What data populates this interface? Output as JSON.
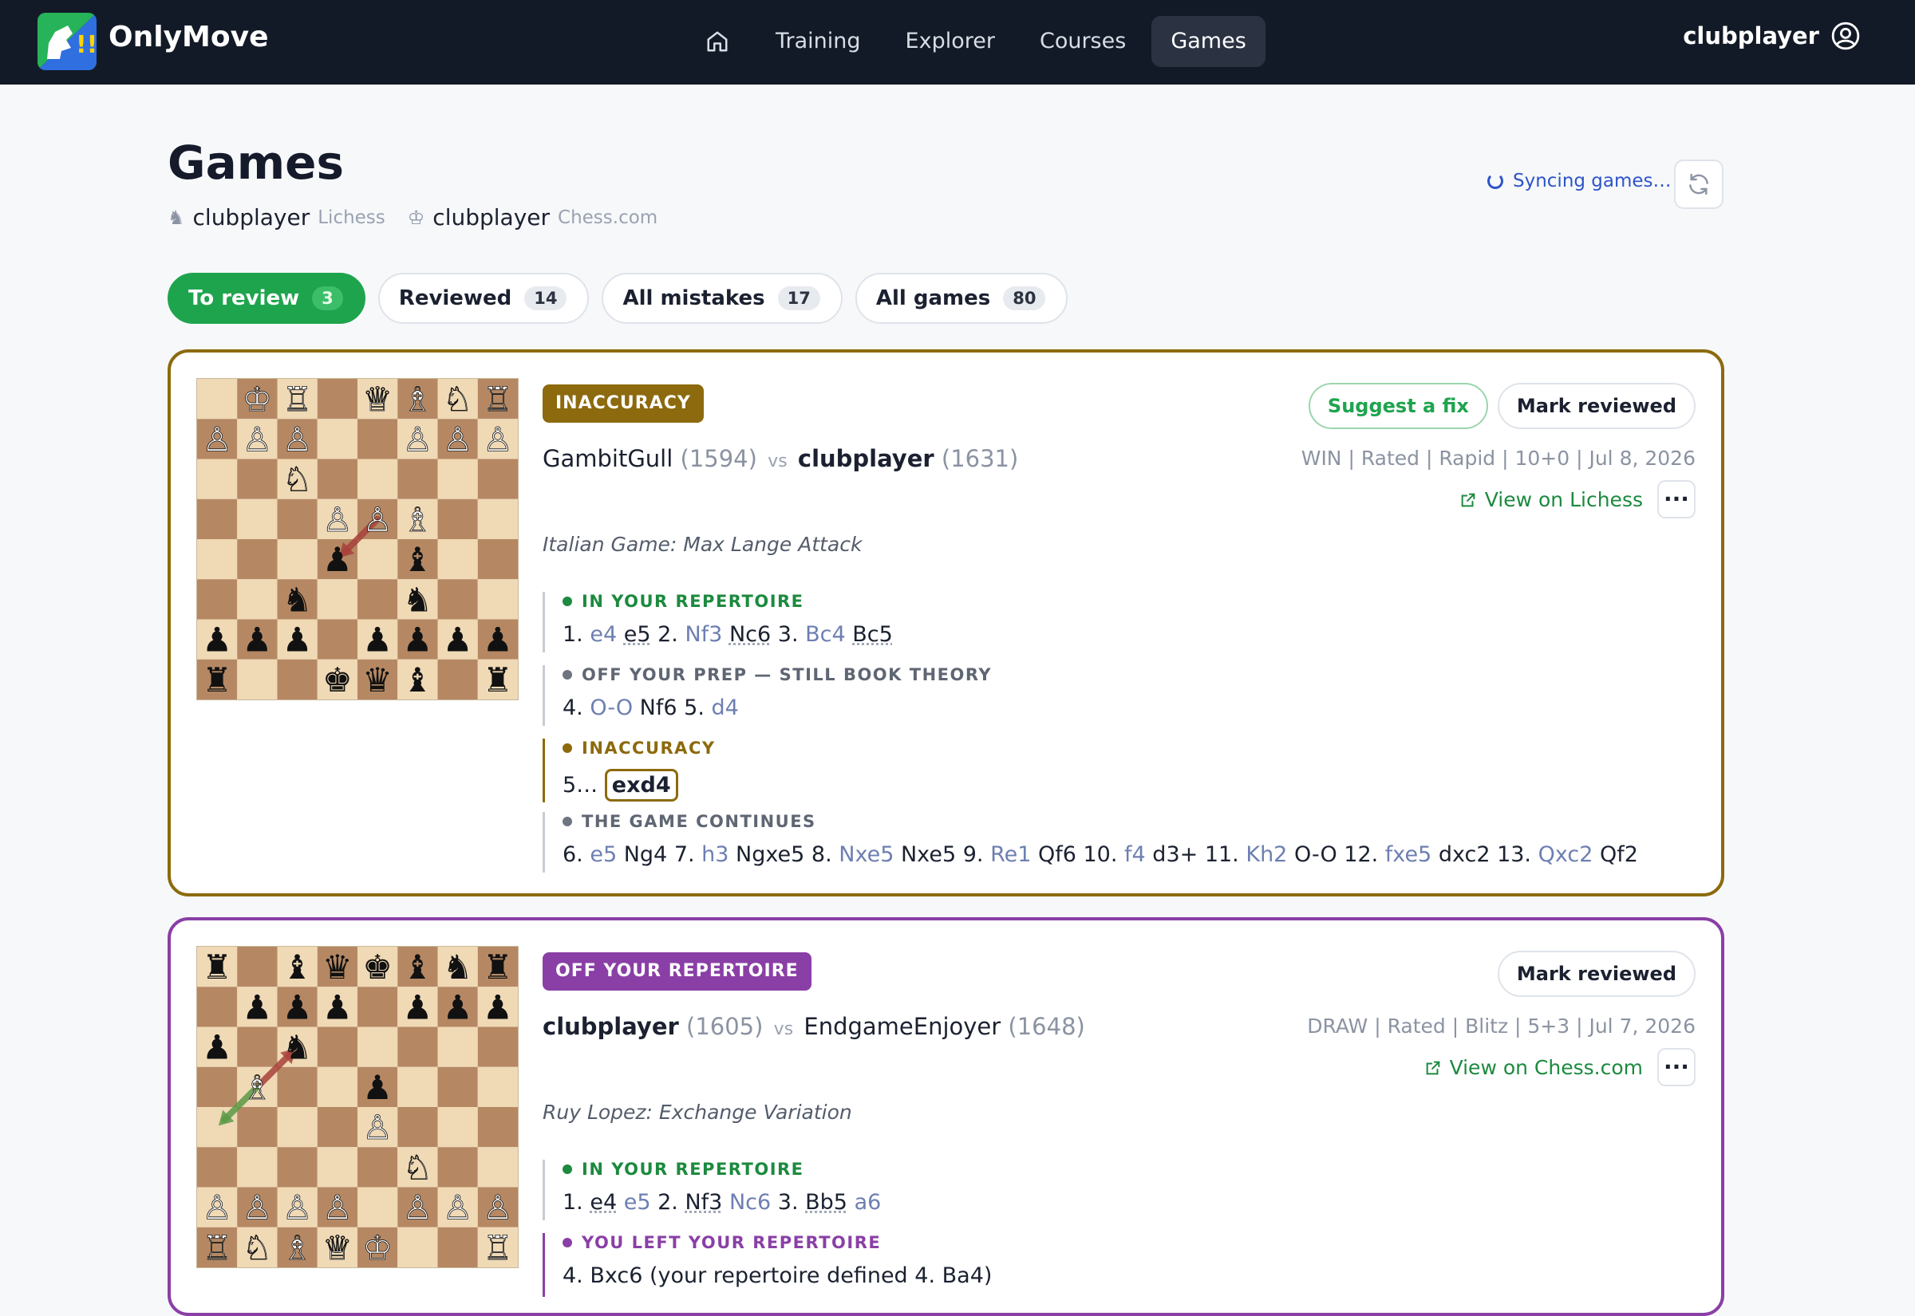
{
  "nav": {
    "brand": "OnlyMove",
    "links": [
      "Training",
      "Explorer",
      "Courses",
      "Games"
    ],
    "active": "Games",
    "user": "clubplayer"
  },
  "header": {
    "title": "Games",
    "accounts": [
      {
        "name": "clubplayer",
        "source": "Lichess"
      },
      {
        "name": "clubplayer",
        "source": "Chess.com"
      }
    ],
    "sync_status": "Syncing games…"
  },
  "tabs": [
    {
      "label": "To review",
      "count": "3",
      "active": true
    },
    {
      "label": "Reviewed",
      "count": "14"
    },
    {
      "label": "All mistakes",
      "count": "17"
    },
    {
      "label": "All games",
      "count": "80"
    }
  ],
  "games": [
    {
      "badge": "INACCURACY",
      "badge_color": "#8c6a0d",
      "white": "GambitGull",
      "white_rating": "(1594)",
      "black": "clubplayer",
      "black_rating": "(1631)",
      "vs": "vs",
      "meta": "WIN | Rated | Rapid | 10+0 | Jul 8, 2026",
      "view_link": "View on Lichess",
      "actions": [
        "Suggest a fix",
        "Mark reviewed"
      ],
      "opening": "Italian Game: Max Lange Attack",
      "sections": [
        {
          "label": "IN YOUR REPERTOIRE",
          "moves": "1. e4 e5 2. Nf3 Nc6 3. Bc4 Bc5"
        },
        {
          "label": "OFF YOUR PREP — STILL BOOK THEORY",
          "moves": "4. O-O Nf6 5. d4"
        },
        {
          "label": "INACCURACY",
          "prefix": "5…",
          "move": "exd4"
        },
        {
          "label": "THE GAME CONTINUES",
          "moves": "6. e5 Ng4 7. h3 Ngxe5 8. Nxe5 Nxe5 9. Re1 Qf6 10. f4 d3+ 11. Kh2 O-O 12. fxe5 dxc2 13. Qxc2 Qf2"
        }
      ],
      "board": [
        [
          ".",
          "K",
          "R",
          ".",
          "Q",
          "B",
          "N",
          "R"
        ],
        [
          "P",
          "P",
          "P",
          ".",
          ".",
          "P",
          "P",
          "P"
        ],
        [
          ".",
          ".",
          "N",
          ".",
          ".",
          ".",
          ".",
          "."
        ],
        [
          ".",
          ".",
          ".",
          "P",
          "P",
          "B",
          ".",
          "."
        ],
        [
          ".",
          ".",
          ".",
          "p",
          ".",
          "b",
          ".",
          "."
        ],
        [
          ".",
          ".",
          "n",
          ".",
          ".",
          "n",
          ".",
          "."
        ],
        [
          "p",
          "p",
          "p",
          ".",
          "p",
          "p",
          "p",
          "p"
        ],
        [
          "r",
          ".",
          ".",
          "k",
          "q",
          "b",
          ".",
          "r"
        ]
      ]
    },
    {
      "badge": "OFF YOUR REPERTOIRE",
      "badge_color": "#8a3fa6",
      "white": "clubplayer",
      "white_rating": "(1605)",
      "black": "EndgameEnjoyer",
      "black_rating": "(1648)",
      "vs": "vs",
      "meta": "DRAW | Rated | Blitz | 5+3 | Jul 7, 2026",
      "view_link": "View on Chess.com",
      "actions": [
        "Mark reviewed"
      ],
      "opening": "Ruy Lopez: Exchange Variation",
      "sections": [
        {
          "label": "IN YOUR REPERTOIRE",
          "moves": "1. e4 e5 2. Nf3 Nc6 3. Bb5 a6"
        },
        {
          "label": "YOU LEFT YOUR REPERTOIRE",
          "moves": "4. Bxc6 (your repertoire defined 4. Ba4)"
        }
      ],
      "board": [
        [
          "r",
          ".",
          "b",
          "q",
          "k",
          "b",
          "n",
          "r"
        ],
        [
          ".",
          "p",
          "p",
          "p",
          ".",
          "p",
          "p",
          "p"
        ],
        [
          "p",
          ".",
          "n",
          ".",
          ".",
          ".",
          ".",
          "."
        ],
        [
          ".",
          "B",
          ".",
          ".",
          "p",
          ".",
          ".",
          "."
        ],
        [
          ".",
          ".",
          ".",
          ".",
          "P",
          ".",
          ".",
          "."
        ],
        [
          ".",
          ".",
          ".",
          ".",
          ".",
          "N",
          ".",
          "."
        ],
        [
          "P",
          "P",
          "P",
          "P",
          ".",
          "P",
          "P",
          "P"
        ],
        [
          "R",
          "N",
          "B",
          "Q",
          "K",
          ".",
          ".",
          "R"
        ]
      ]
    }
  ]
}
